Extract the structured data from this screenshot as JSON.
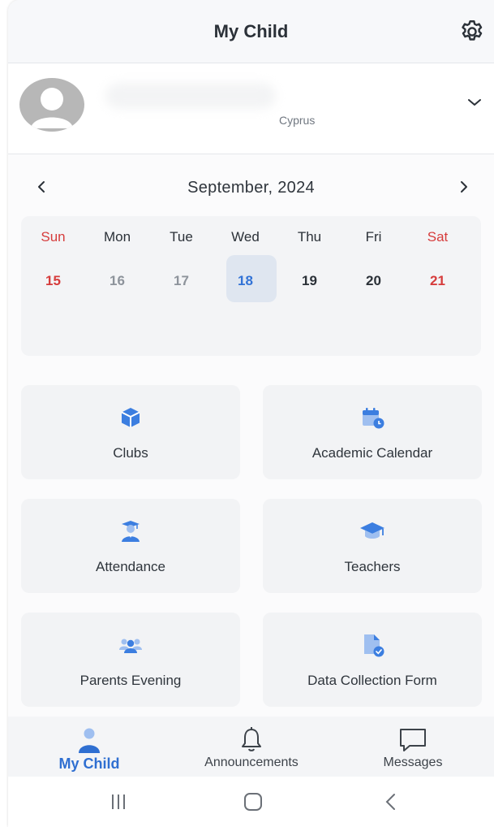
{
  "header": {
    "title": "My Child"
  },
  "profile": {
    "country": "Cyprus"
  },
  "calendar": {
    "month_label": "September, 2024",
    "weekdays": [
      "Sun",
      "Mon",
      "Tue",
      "Wed",
      "Thu",
      "Fri",
      "Sat"
    ],
    "dates": [
      "15",
      "16",
      "17",
      "18",
      "19",
      "20",
      "21"
    ],
    "selected_date": "18"
  },
  "tiles": [
    {
      "label": "Clubs",
      "icon": "cube-icon"
    },
    {
      "label": "Academic Calendar",
      "icon": "calendar-clock-icon"
    },
    {
      "label": "Attendance",
      "icon": "graduate-student-icon"
    },
    {
      "label": "Teachers",
      "icon": "graduation-cap-icon"
    },
    {
      "label": "Parents Evening",
      "icon": "users-group-icon"
    },
    {
      "label": "Data Collection Form",
      "icon": "document-check-icon"
    }
  ],
  "bottom_nav": [
    {
      "label": "My Child",
      "icon": "person-icon",
      "active": true
    },
    {
      "label": "Announcements",
      "icon": "bell-icon",
      "active": false
    },
    {
      "label": "Messages",
      "icon": "chat-bubble-icon",
      "active": false
    }
  ],
  "colors": {
    "accent": "#3273d6",
    "weekend": "#d63c3c",
    "tile_bg": "#f2f3f5"
  }
}
